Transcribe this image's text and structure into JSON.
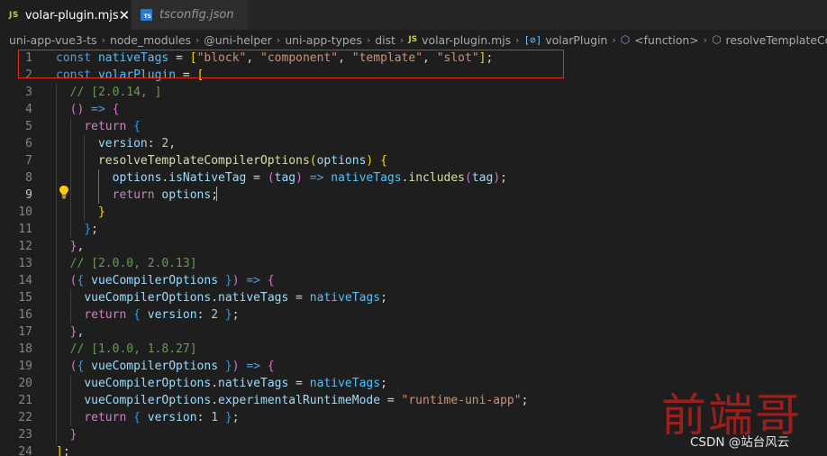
{
  "tabs": [
    {
      "badge": "JS",
      "label": "volar-plugin.mjs",
      "active": true,
      "close": "✕"
    },
    {
      "badge": "TS",
      "label": "tsconfig.json",
      "active": false
    }
  ],
  "breadcrumb": {
    "items": [
      "uni-app-vue3-ts",
      "node_modules",
      "@uni-helper",
      "uni-app-types",
      "dist"
    ],
    "file_badge": "JS",
    "file": "volar-plugin.mjs",
    "var_icon": "[⊘]",
    "symbol": "volarPlugin",
    "cube_icon": "⬡",
    "function": "<function>",
    "method": "resolveTemplateCompilerOptions"
  },
  "editor": {
    "line_numbers": [
      "1",
      "2",
      "3",
      "4",
      "5",
      "6",
      "7",
      "8",
      "9",
      "10",
      "11",
      "12",
      "13",
      "14",
      "15",
      "16",
      "17",
      "18",
      "19",
      "20",
      "21",
      "22",
      "23",
      "24"
    ],
    "current_line": 9,
    "highlight_color": "#e0301e",
    "lines": [
      [
        [
          "kw",
          "const "
        ],
        [
          "cn",
          "nativeTags"
        ],
        [
          "p",
          " = "
        ],
        [
          "b1",
          "["
        ],
        [
          "s",
          "\"block\""
        ],
        [
          "p",
          ", "
        ],
        [
          "s",
          "\"component\""
        ],
        [
          "p",
          ", "
        ],
        [
          "s",
          "\"template\""
        ],
        [
          "p",
          ", "
        ],
        [
          "s",
          "\"slot\""
        ],
        [
          "b1",
          "]"
        ],
        [
          "p",
          ";"
        ]
      ],
      [
        [
          "kw",
          "const "
        ],
        [
          "cn",
          "volarPlugin"
        ],
        [
          "p",
          " = "
        ],
        [
          "b1",
          "["
        ]
      ],
      [
        [
          "p",
          "  "
        ],
        [
          "c",
          "// [2.0.14, ]"
        ]
      ],
      [
        [
          "p",
          "  "
        ],
        [
          "b2",
          "("
        ],
        [
          "b2",
          ")"
        ],
        [
          "p",
          " "
        ],
        [
          "kw",
          "=>"
        ],
        [
          "p",
          " "
        ],
        [
          "b2",
          "{"
        ]
      ],
      [
        [
          "p",
          "    "
        ],
        [
          "ctl",
          "return"
        ],
        [
          "p",
          " "
        ],
        [
          "b3",
          "{"
        ]
      ],
      [
        [
          "p",
          "      "
        ],
        [
          "v",
          "version"
        ],
        [
          "p",
          ": "
        ],
        [
          "n",
          "2"
        ],
        [
          "p",
          ","
        ]
      ],
      [
        [
          "p",
          "      "
        ],
        [
          "fn",
          "resolveTemplateCompilerOptions"
        ],
        [
          "b1",
          "("
        ],
        [
          "v",
          "options"
        ],
        [
          "b1",
          ")"
        ],
        [
          "p",
          " "
        ],
        [
          "b1",
          "{"
        ]
      ],
      [
        [
          "p",
          "        "
        ],
        [
          "v",
          "options"
        ],
        [
          "p",
          "."
        ],
        [
          "v",
          "isNativeTag"
        ],
        [
          "p",
          " = "
        ],
        [
          "b2",
          "("
        ],
        [
          "v",
          "tag"
        ],
        [
          "b2",
          ")"
        ],
        [
          "p",
          " "
        ],
        [
          "kw",
          "=>"
        ],
        [
          "p",
          " "
        ],
        [
          "cn",
          "nativeTags"
        ],
        [
          "p",
          "."
        ],
        [
          "fn",
          "includes"
        ],
        [
          "b2",
          "("
        ],
        [
          "v",
          "tag"
        ],
        [
          "b2",
          ")"
        ],
        [
          "p",
          ";"
        ]
      ],
      [
        [
          "p",
          "        "
        ],
        [
          "ctl",
          "return"
        ],
        [
          "p",
          " "
        ],
        [
          "v",
          "options"
        ],
        [
          "p",
          ";"
        ]
      ],
      [
        [
          "p",
          "      "
        ],
        [
          "b1",
          "}"
        ]
      ],
      [
        [
          "p",
          "    "
        ],
        [
          "b3",
          "}"
        ],
        [
          "p",
          ";"
        ]
      ],
      [
        [
          "p",
          "  "
        ],
        [
          "b2",
          "}"
        ],
        [
          "p",
          ","
        ]
      ],
      [
        [
          "p",
          "  "
        ],
        [
          "c",
          "// [2.0.0, 2.0.13]"
        ]
      ],
      [
        [
          "p",
          "  "
        ],
        [
          "b2",
          "("
        ],
        [
          "b3",
          "{"
        ],
        [
          "p",
          " "
        ],
        [
          "v",
          "vueCompilerOptions"
        ],
        [
          "p",
          " "
        ],
        [
          "b3",
          "}"
        ],
        [
          "b2",
          ")"
        ],
        [
          "p",
          " "
        ],
        [
          "kw",
          "=>"
        ],
        [
          "p",
          " "
        ],
        [
          "b2",
          "{"
        ]
      ],
      [
        [
          "p",
          "    "
        ],
        [
          "v",
          "vueCompilerOptions"
        ],
        [
          "p",
          "."
        ],
        [
          "v",
          "nativeTags"
        ],
        [
          "p",
          " = "
        ],
        [
          "cn",
          "nativeTags"
        ],
        [
          "p",
          ";"
        ]
      ],
      [
        [
          "p",
          "    "
        ],
        [
          "ctl",
          "return"
        ],
        [
          "p",
          " "
        ],
        [
          "b3",
          "{"
        ],
        [
          "p",
          " "
        ],
        [
          "v",
          "version"
        ],
        [
          "p",
          ": "
        ],
        [
          "n",
          "2"
        ],
        [
          "p",
          " "
        ],
        [
          "b3",
          "}"
        ],
        [
          "p",
          ";"
        ]
      ],
      [
        [
          "p",
          "  "
        ],
        [
          "b2",
          "}"
        ],
        [
          "p",
          ","
        ]
      ],
      [
        [
          "p",
          "  "
        ],
        [
          "c",
          "// [1.0.0, 1.8.27]"
        ]
      ],
      [
        [
          "p",
          "  "
        ],
        [
          "b2",
          "("
        ],
        [
          "b3",
          "{"
        ],
        [
          "p",
          " "
        ],
        [
          "v",
          "vueCompilerOptions"
        ],
        [
          "p",
          " "
        ],
        [
          "b3",
          "}"
        ],
        [
          "b2",
          ")"
        ],
        [
          "p",
          " "
        ],
        [
          "kw",
          "=>"
        ],
        [
          "p",
          " "
        ],
        [
          "b2",
          "{"
        ]
      ],
      [
        [
          "p",
          "    "
        ],
        [
          "v",
          "vueCompilerOptions"
        ],
        [
          "p",
          "."
        ],
        [
          "v",
          "nativeTags"
        ],
        [
          "p",
          " = "
        ],
        [
          "cn",
          "nativeTags"
        ],
        [
          "p",
          ";"
        ]
      ],
      [
        [
          "p",
          "    "
        ],
        [
          "v",
          "vueCompilerOptions"
        ],
        [
          "p",
          "."
        ],
        [
          "v",
          "experimentalRuntimeMode"
        ],
        [
          "p",
          " = "
        ],
        [
          "s",
          "\"runtime-uni-app\""
        ],
        [
          "p",
          ";"
        ]
      ],
      [
        [
          "p",
          "    "
        ],
        [
          "ctl",
          "return"
        ],
        [
          "p",
          " "
        ],
        [
          "b3",
          "{"
        ],
        [
          "p",
          " "
        ],
        [
          "v",
          "version"
        ],
        [
          "p",
          ": "
        ],
        [
          "n",
          "1"
        ],
        [
          "p",
          " "
        ],
        [
          "b3",
          "}"
        ],
        [
          "p",
          ";"
        ]
      ],
      [
        [
          "p",
          "  "
        ],
        [
          "b2",
          "}"
        ]
      ],
      [
        [
          "b1",
          "]"
        ],
        [
          "p",
          ";"
        ]
      ]
    ]
  },
  "watermark": {
    "chinese": "前端哥",
    "csdn": "CSDN @站台风云"
  }
}
